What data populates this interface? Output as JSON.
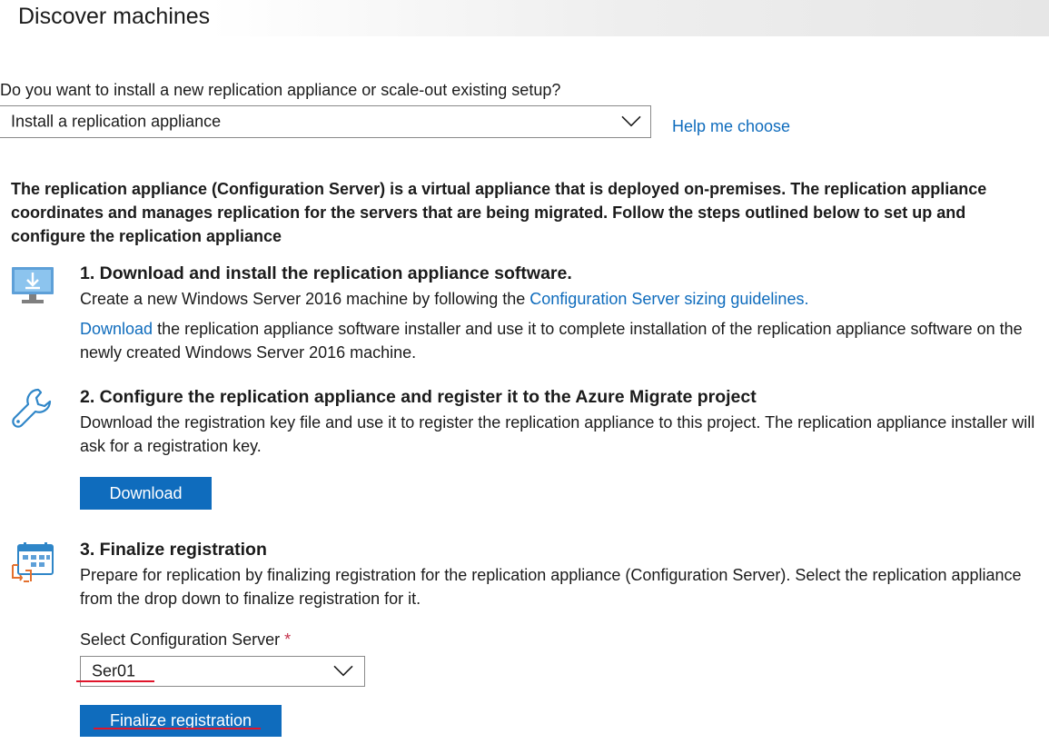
{
  "header": {
    "title": "Discover machines"
  },
  "setup": {
    "question": "Do you want to install a new replication appliance or scale-out existing setup?",
    "selected_option": "Install a replication appliance",
    "help_link": "Help me choose"
  },
  "intro": "The replication appliance (Configuration Server) is a virtual appliance that is deployed on-premises. The replication appliance coordinates and manages replication for the servers that are being migrated. Follow the steps outlined below to set up and configure the replication appliance",
  "step1": {
    "title": "1. Download and install the replication appliance software.",
    "line1_text": "Create a new Windows Server 2016 machine by following the",
    "sizing_link": "Configuration Server sizing guidelines.",
    "download_link": "Download",
    "line2_text": " the replication appliance software installer and use it to complete installation of the replication appliance software on the newly created Windows Server 2016 machine.",
    "icon": "monitor-download-icon"
  },
  "step2": {
    "title": "2. Configure the replication appliance and register it to the Azure Migrate project",
    "text": "Download the registration key file and use it to register the replication appliance to this project. The replication appliance installer will ask for a registration key.",
    "button_label": "Download",
    "icon": "wrench-icon"
  },
  "step3": {
    "title": "3. Finalize registration",
    "text": "Prepare for replication by finalizing registration for the replication appliance (Configuration Server). Select the replication appliance from the drop down to finalize registration for it.",
    "field_label": "Select Configuration Server",
    "required_marker": "*",
    "selected_server": "Ser01",
    "button_label": "Finalize registration",
    "icon": "calendar-icon"
  },
  "colors": {
    "link": "#0f6cbd",
    "button": "#0f6cbd",
    "annotation_underline": "#e0152b",
    "required": "#c4314b"
  }
}
